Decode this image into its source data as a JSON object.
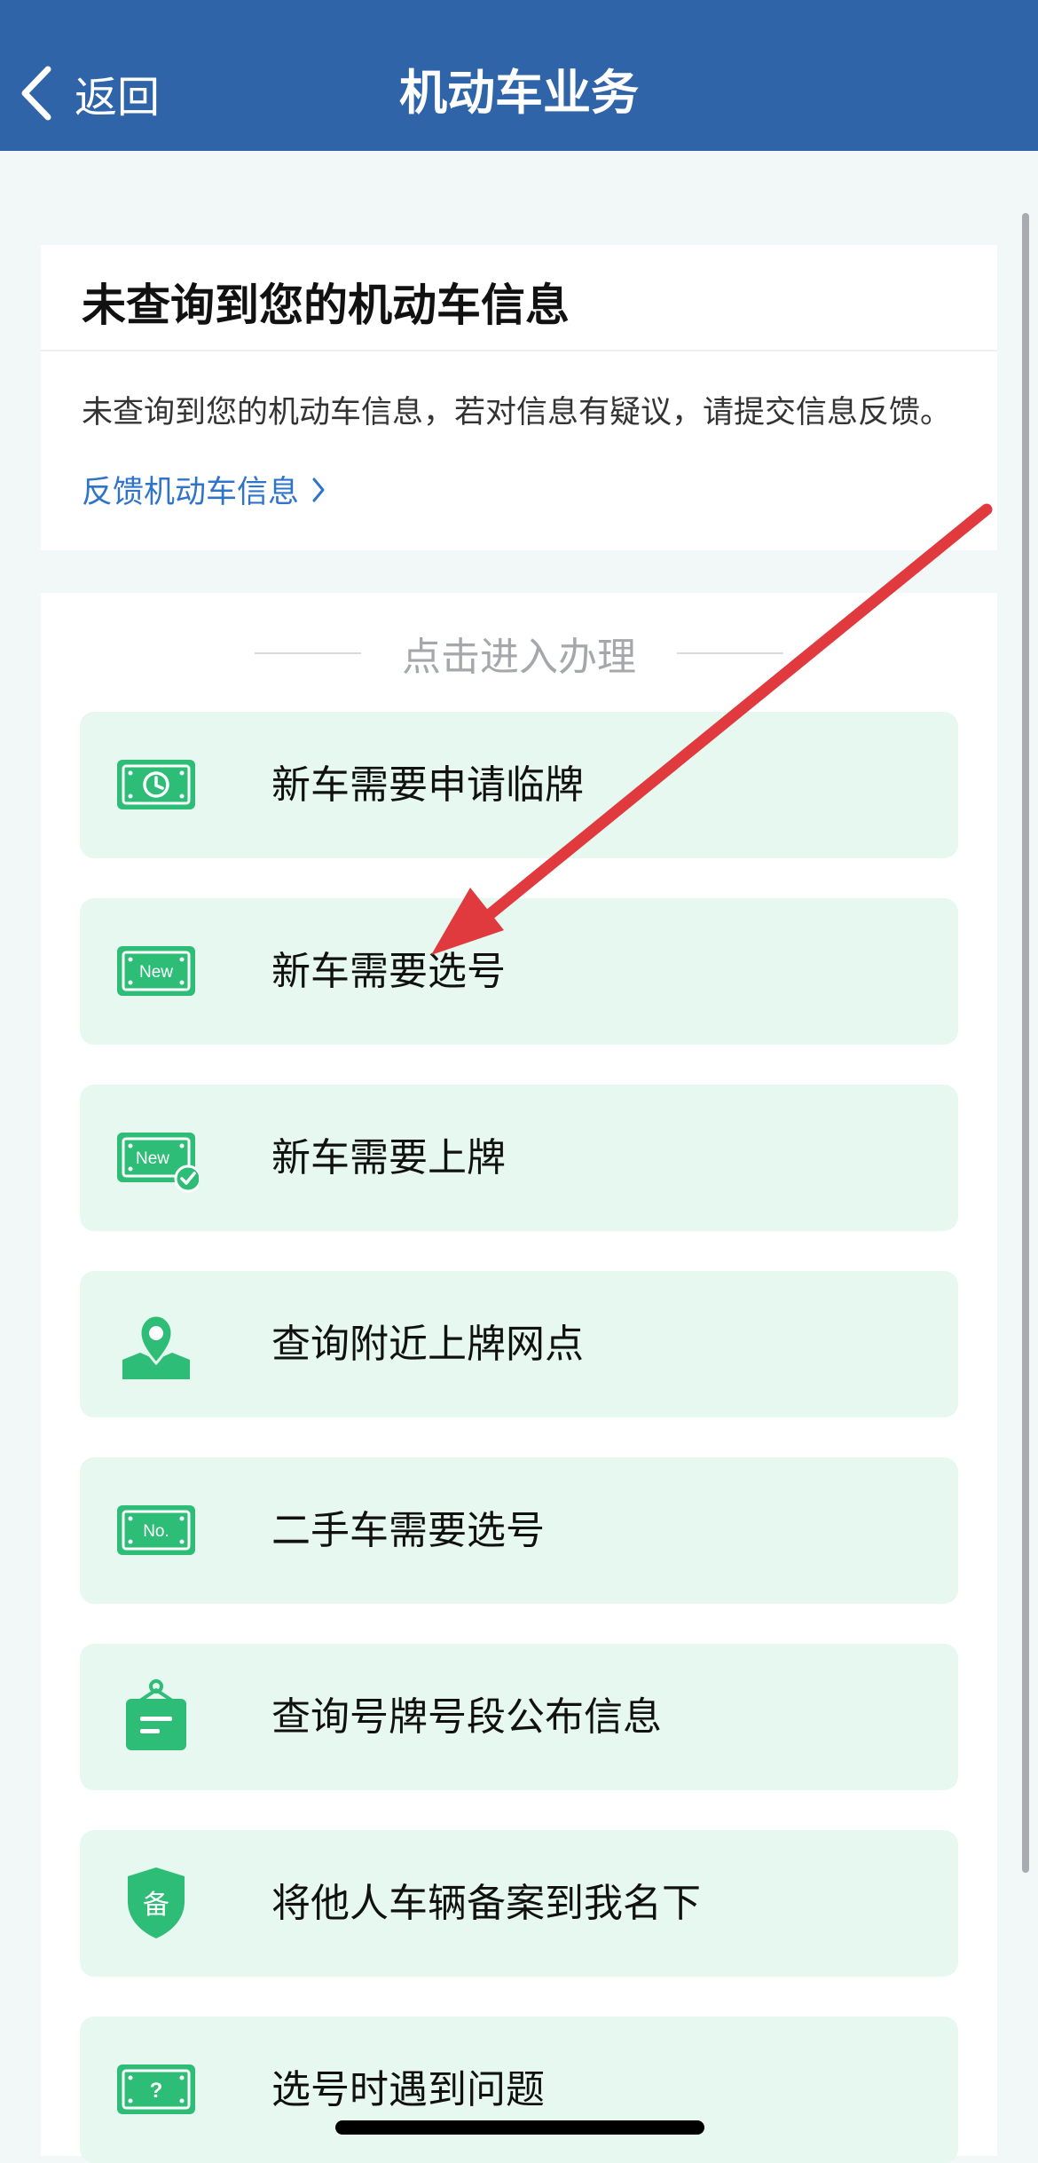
{
  "nav": {
    "back_label": "返回",
    "title": "机动车业务"
  },
  "info_card": {
    "title": "未查询到您的机动车信息",
    "description": "未查询到您的机动车信息，若对信息有疑议，请提交信息反馈。",
    "link_label": "反馈机动车信息"
  },
  "services": {
    "section_title": "点击进入办理",
    "items": [
      {
        "label": "新车需要申请临牌",
        "icon": "temporary-plate-clock-icon"
      },
      {
        "label": "新车需要选号",
        "icon": "new-plate-icon",
        "badge": "New"
      },
      {
        "label": "新车需要上牌",
        "icon": "new-plate-check-icon",
        "badge": "New"
      },
      {
        "label": "查询附近上牌网点",
        "icon": "location-pin-icon"
      },
      {
        "label": "二手车需要选号",
        "icon": "number-plate-icon",
        "badge": "No."
      },
      {
        "label": "查询号牌号段公布信息",
        "icon": "bulletin-board-icon"
      },
      {
        "label": "将他人车辆备案到我名下",
        "icon": "shield-record-icon",
        "badge": "备"
      },
      {
        "label": "选号时遇到问题",
        "icon": "question-plate-icon",
        "badge": "?"
      }
    ]
  },
  "colors": {
    "nav_background": "#2f64a8",
    "icon_green": "#2dbd76",
    "item_background": "#e6f8f0",
    "link_blue": "#2f74c8",
    "annotation_arrow": "#e03a3e"
  }
}
